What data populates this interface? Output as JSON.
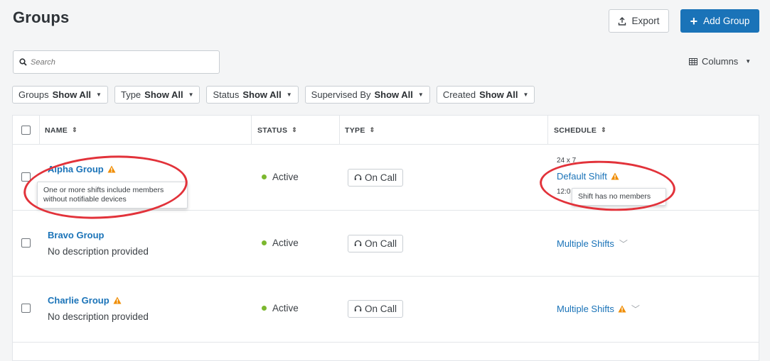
{
  "page": {
    "title": "Groups"
  },
  "toolbar": {
    "export_label": "Export",
    "add_group_label": "Add Group"
  },
  "search": {
    "placeholder": "Search"
  },
  "columns_button": {
    "label": "Columns"
  },
  "filters": [
    {
      "label": "Groups",
      "value": "Show All"
    },
    {
      "label": "Type",
      "value": "Show All"
    },
    {
      "label": "Status",
      "value": "Show All"
    },
    {
      "label": "Supervised By",
      "value": "Show All"
    },
    {
      "label": "Created",
      "value": "Show All"
    }
  ],
  "table": {
    "headers": {
      "name": "NAME",
      "status": "STATUS",
      "type": "TYPE",
      "schedule": "SCHEDULE"
    },
    "rows": [
      {
        "name": "Alpha Group",
        "status": "Active",
        "type": "On Call",
        "schedule_top": "24 x 7",
        "schedule": "Default Shift",
        "schedule_bottom": "12:0",
        "name_tooltip_line1": "One or more shifts include members",
        "name_tooltip_line2": "without notifiable devices",
        "schedule_tooltip": "Shift has no members"
      },
      {
        "name": "Bravo Group",
        "description": "No description provided",
        "status": "Active",
        "type": "On Call",
        "schedule": "Multiple Shifts"
      },
      {
        "name": "Charlie Group",
        "description": "No description provided",
        "status": "Active",
        "type": "On Call",
        "schedule": "Multiple Shifts"
      }
    ]
  },
  "colors": {
    "accent": "#1a73b8",
    "warning": "#f08c00",
    "active": "#7cb82f",
    "highlight": "#e2323a"
  }
}
